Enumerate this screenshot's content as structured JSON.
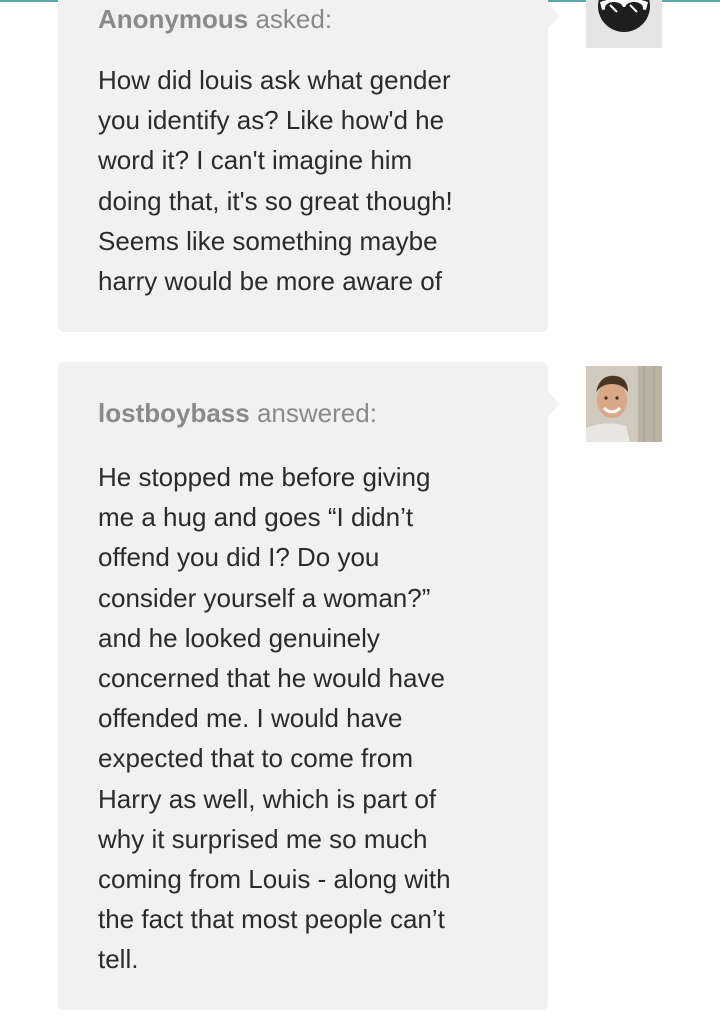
{
  "ask": {
    "asker_name": "Anonymous",
    "verb": "asked:",
    "question": "How did louis ask what gender\nyou identify as? Like how'd he\nword it? I can't imagine him\ndoing that, it's so great though!\nSeems like something maybe\nharry would be more aware of"
  },
  "answer": {
    "answerer_name": "lostboybass",
    "verb": "answered:",
    "text": "He stopped me before giving\nme a hug and goes “I didn’t\noffend you did I? Do you\nconsider yourself a woman?”\nand he looked genuinely\nconcerned that he would have\noffended me. I would have\nexpected that to come from\nHarry as well, which is part of\nwhy it surprised me so much\ncoming from Louis - along with\nthe fact that most people can’t\ntell."
  },
  "colors": {
    "top_border": "#5aa6ad",
    "bubble": "#f1f1f1",
    "header_text": "#8a8a8a",
    "body_text": "#2b2b2b"
  },
  "icons": {
    "anonymous_avatar": "anonymous-sunglasses-icon",
    "user_avatar": "user-photo-avatar"
  }
}
